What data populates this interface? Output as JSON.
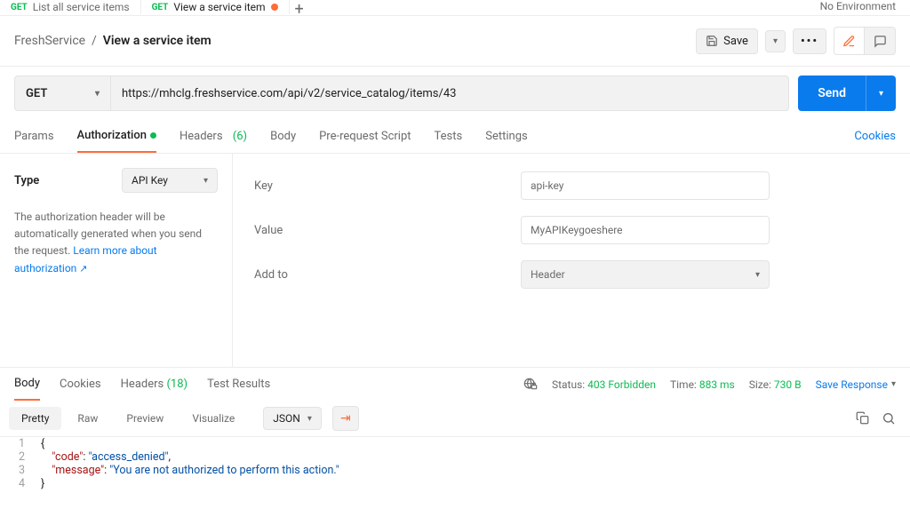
{
  "tabs": {
    "prev": {
      "method": "GET",
      "label": "List all service items"
    },
    "active": {
      "method": "GET",
      "label": "View a service item"
    }
  },
  "env": "No Environment",
  "breadcrumb": {
    "collection": "FreshService",
    "item": "View a service item",
    "save": "Save"
  },
  "request": {
    "method": "GET",
    "url": "https://mhclg.freshservice.com/api/v2/service_catalog/items/43",
    "send": "Send"
  },
  "reqTabs": {
    "params": "Params",
    "auth": "Authorization",
    "headers": "Headers",
    "headers_count": "(6)",
    "body": "Body",
    "prs": "Pre-request Script",
    "tests": "Tests",
    "settings": "Settings",
    "cookies": "Cookies"
  },
  "auth": {
    "typeLabel": "Type",
    "typeValue": "API Key",
    "desc1": "The authorization header will be automatically generated when you send the request. ",
    "learn": "Learn more about authorization",
    "key_label": "Key",
    "key_value": "api-key",
    "value_label": "Value",
    "value_value": "MyAPIKeygoeshere",
    "addto_label": "Add to",
    "addto_value": "Header"
  },
  "respTabs": {
    "body": "Body",
    "cookies": "Cookies",
    "headers": "Headers",
    "headers_count": "(18)",
    "tests": "Test Results"
  },
  "respMeta": {
    "status_label": "Status:",
    "status_value": "403 Forbidden",
    "time_label": "Time:",
    "time_value": "883 ms",
    "size_label": "Size:",
    "size_value": "730 B",
    "save": "Save Response"
  },
  "subTabs": {
    "pretty": "Pretty",
    "raw": "Raw",
    "preview": "Preview",
    "visualize": "Visualize",
    "lang": "JSON"
  },
  "responseBody": {
    "code_key": "\"code\"",
    "code_val": "\"access_denied\"",
    "msg_key": "\"message\"",
    "msg_val": "\"You are not authorized to perform this action.\""
  },
  "lineNumbers": [
    "1",
    "2",
    "3",
    "4"
  ]
}
